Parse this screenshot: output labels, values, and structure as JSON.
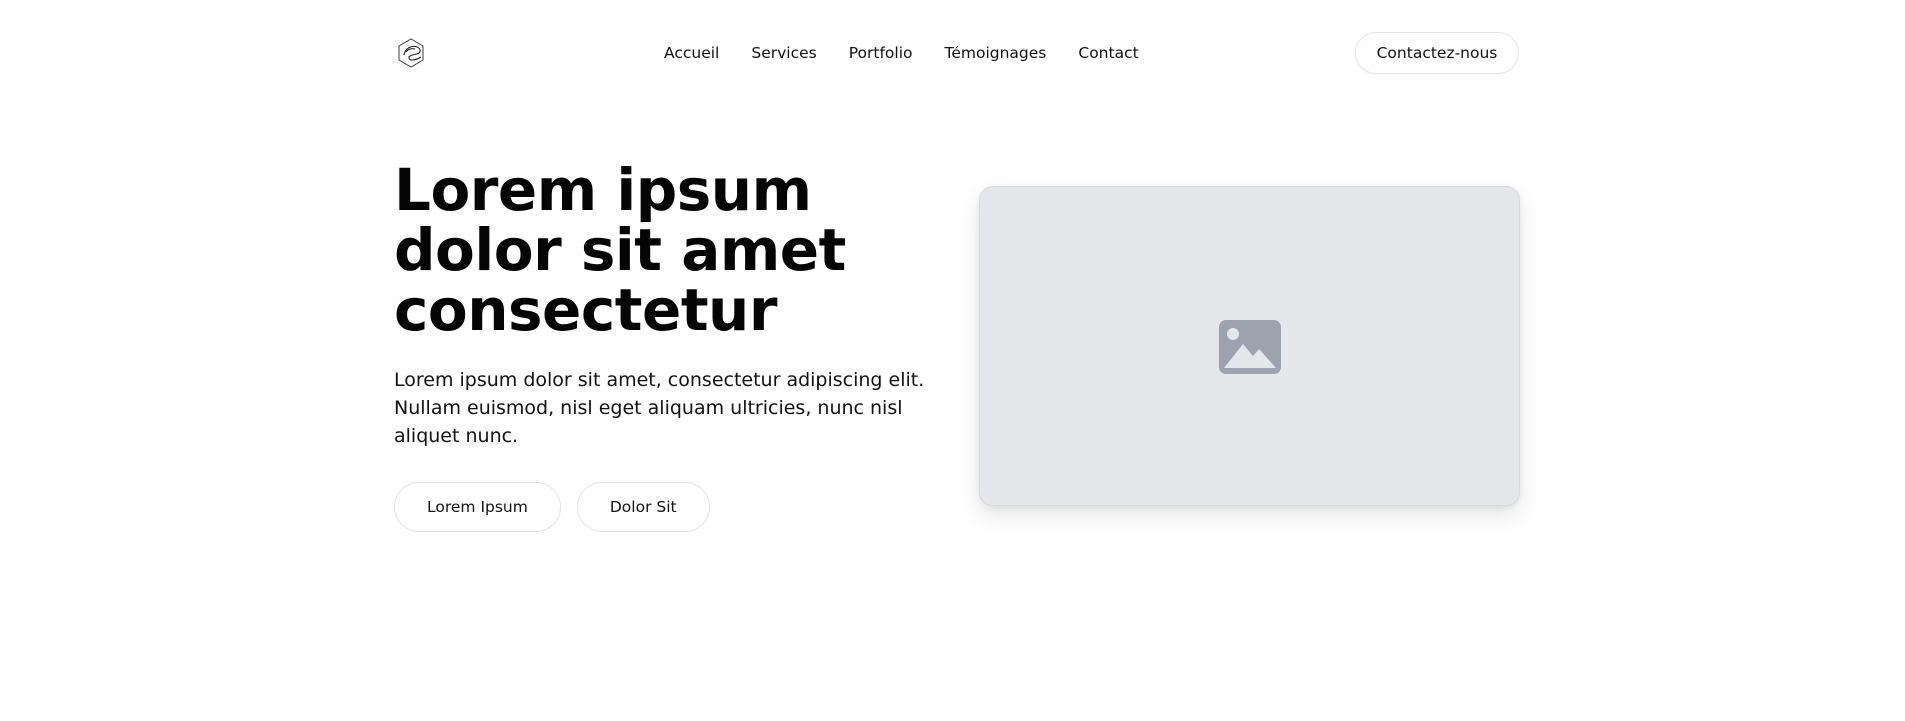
{
  "header": {
    "logo_icon": "hexagon-logo-icon",
    "nav": [
      {
        "label": "Accueil"
      },
      {
        "label": "Services"
      },
      {
        "label": "Portfolio"
      },
      {
        "label": "Témoignages"
      },
      {
        "label": "Contact"
      }
    ],
    "contact_button_label": "Contactez-nous"
  },
  "hero": {
    "title": "Lorem ipsum dolor sit amet consectetur",
    "description": "Lorem ipsum dolor sit amet, consectetur adipiscing elit. Nullam euismod, nisl eget aliquam ultricies, nunc nisl aliquet nunc.",
    "primary_button_label": "Lorem Ipsum",
    "secondary_button_label": "Dolor Sit",
    "image_placeholder_icon": "image-icon"
  },
  "colors": {
    "placeholder_bg": "#e5e7eb",
    "placeholder_icon": "#9ca3af",
    "text": "#111111"
  }
}
